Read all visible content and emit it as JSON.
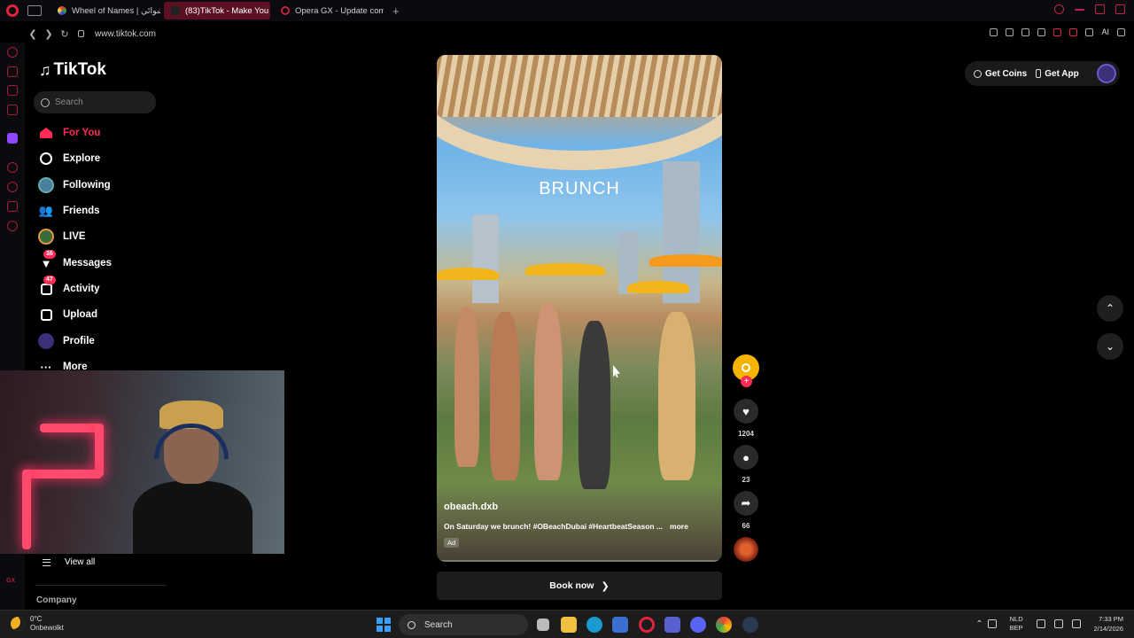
{
  "browser": {
    "tabs": [
      {
        "label": "Wheel of Names | العشوائي",
        "active": false
      },
      {
        "label": "(83)TikTok - Make You",
        "active": true
      },
      {
        "label": "Opera GX - Update compl",
        "active": false
      }
    ],
    "url": "www.tiktok.com",
    "ai_label": "AI"
  },
  "tiktok": {
    "logo": "TikTok",
    "search_placeholder": "Search",
    "nav": [
      {
        "label": "For You",
        "icon": "home-icon",
        "active": true
      },
      {
        "label": "Explore",
        "icon": "compass-icon"
      },
      {
        "label": "Following",
        "icon": "following-avatar-icon"
      },
      {
        "label": "Friends",
        "icon": "friends-icon"
      },
      {
        "label": "LIVE",
        "icon": "live-icon"
      },
      {
        "label": "Messages",
        "icon": "messages-icon",
        "badge": "36"
      },
      {
        "label": "Activity",
        "icon": "activity-icon",
        "badge": "47"
      },
      {
        "label": "Upload",
        "icon": "upload-icon"
      },
      {
        "label": "Profile",
        "icon": "profile-avatar-icon"
      },
      {
        "label": "More",
        "icon": "more-icon"
      }
    ],
    "view_all": "View all",
    "company": "Company",
    "top_buttons": {
      "coins": "Get Coins",
      "app": "Get App"
    },
    "video": {
      "overlay_text": "BRUNCH",
      "username": "obeach.dxb",
      "caption": "On Saturday we brunch! #OBeachDubai #HeartbeatSeason ...",
      "more": "more",
      "ad": "Ad",
      "likes": "1204",
      "comments": "23",
      "shares": "66",
      "cta": "Book now"
    }
  },
  "taskbar": {
    "temperature": "0°C",
    "weather": "Onbewolkt",
    "search": "Search",
    "lang_top": "NLD",
    "lang_bottom": "BEP",
    "time": "7:33 PM",
    "date": "2/14/2026"
  },
  "colors": {
    "tiktok_red": "#fe2c55",
    "opera_red": "#a81d3a"
  }
}
